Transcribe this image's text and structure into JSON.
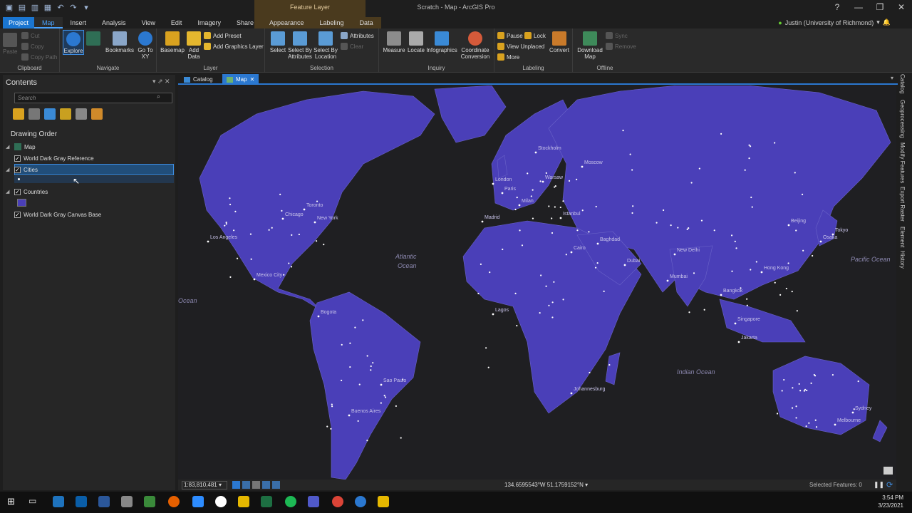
{
  "titlebar": {
    "context_group": "Feature Layer",
    "title": "Scratch - Map - ArcGIS Pro",
    "help": "?",
    "minimize": "—",
    "restore": "❐",
    "close": "✕"
  },
  "tabs": [
    "Project",
    "Map",
    "Insert",
    "Analysis",
    "View",
    "Edit",
    "Imagery",
    "Share",
    "Appearance",
    "Labeling",
    "Data"
  ],
  "user": {
    "name": "Justin (University of Richmond)",
    "caret": "▾"
  },
  "ribbon": {
    "clipboard": {
      "label": "Clipboard",
      "paste": "Paste",
      "cut": "Cut",
      "copy": "Copy",
      "copy_path": "Copy Path"
    },
    "navigate": {
      "label": "Navigate",
      "explore": "Explore",
      "bookmarks": "Bookmarks",
      "goto": "Go To XY"
    },
    "layer": {
      "label": "Layer",
      "basemap": "Basemap",
      "add_data": "Add Data",
      "add_preset": "Add Preset",
      "add_graphics": "Add Graphics Layer"
    },
    "selection": {
      "label": "Selection",
      "select": "Select",
      "by_attr": "Select By Attributes",
      "by_loc": "Select By Location",
      "attributes": "Attributes",
      "clear": "Clear"
    },
    "inquiry": {
      "label": "Inquiry",
      "measure": "Measure",
      "locate": "Locate",
      "infographics": "Infographics",
      "coord": "Coordinate Conversion"
    },
    "labeling": {
      "label": "Labeling",
      "pause": "Pause",
      "lock": "Lock",
      "view_unplaced": "View Unplaced",
      "more": "More",
      "convert": "Convert"
    },
    "offline": {
      "label": "Offline",
      "download": "Download Map",
      "sync": "Sync",
      "remove": "Remove"
    }
  },
  "contents": {
    "title": "Contents",
    "search_placeholder": "Search",
    "drawing_order": "Drawing Order",
    "layers": [
      "Map",
      "World Dark Gray Reference",
      "Cities",
      "Countries",
      "World Dark Gray Canvas Base"
    ]
  },
  "map_tabs": {
    "catalog": "Catalog",
    "map": "Map"
  },
  "side_panes": [
    "Catalog",
    "Geoprocessing",
    "Modify Features",
    "Export Raster",
    "Element",
    "History"
  ],
  "map_labels": {
    "cities": [
      "Stockholm",
      "Moscow",
      "London",
      "Warsaw",
      "Paris",
      "Milan",
      "Madrid",
      "Istanbul",
      "Cairo",
      "Baghdad",
      "Dubai",
      "New Delhi",
      "Mumbai",
      "Bangkok",
      "Hong Kong",
      "Beijing",
      "Tokyo",
      "Osaka",
      "Singapore",
      "Jakarta",
      "Sydney",
      "Melbourne",
      "Johannesburg",
      "Lagos",
      "Chicago",
      "Toronto",
      "New York",
      "Los Angeles",
      "Mexico City",
      "Bogota",
      "Sao Paulo",
      "Buenos Aires"
    ],
    "oceans": [
      "Atlantic",
      "Ocean",
      "Pacific Ocean",
      "Indian Ocean",
      "Ocean"
    ]
  },
  "status": {
    "scale": "1:83,810,481",
    "coords": "134.6595543°W 51.1759152°N",
    "selected": "Selected Features: 0"
  },
  "clock": {
    "time": "3:54 PM",
    "date": "3/23/2021"
  },
  "colors": {
    "land": "#4a3fb8",
    "ocean": "#1f1f22",
    "accent": "#2b78d0",
    "project": "#1b76d1"
  }
}
